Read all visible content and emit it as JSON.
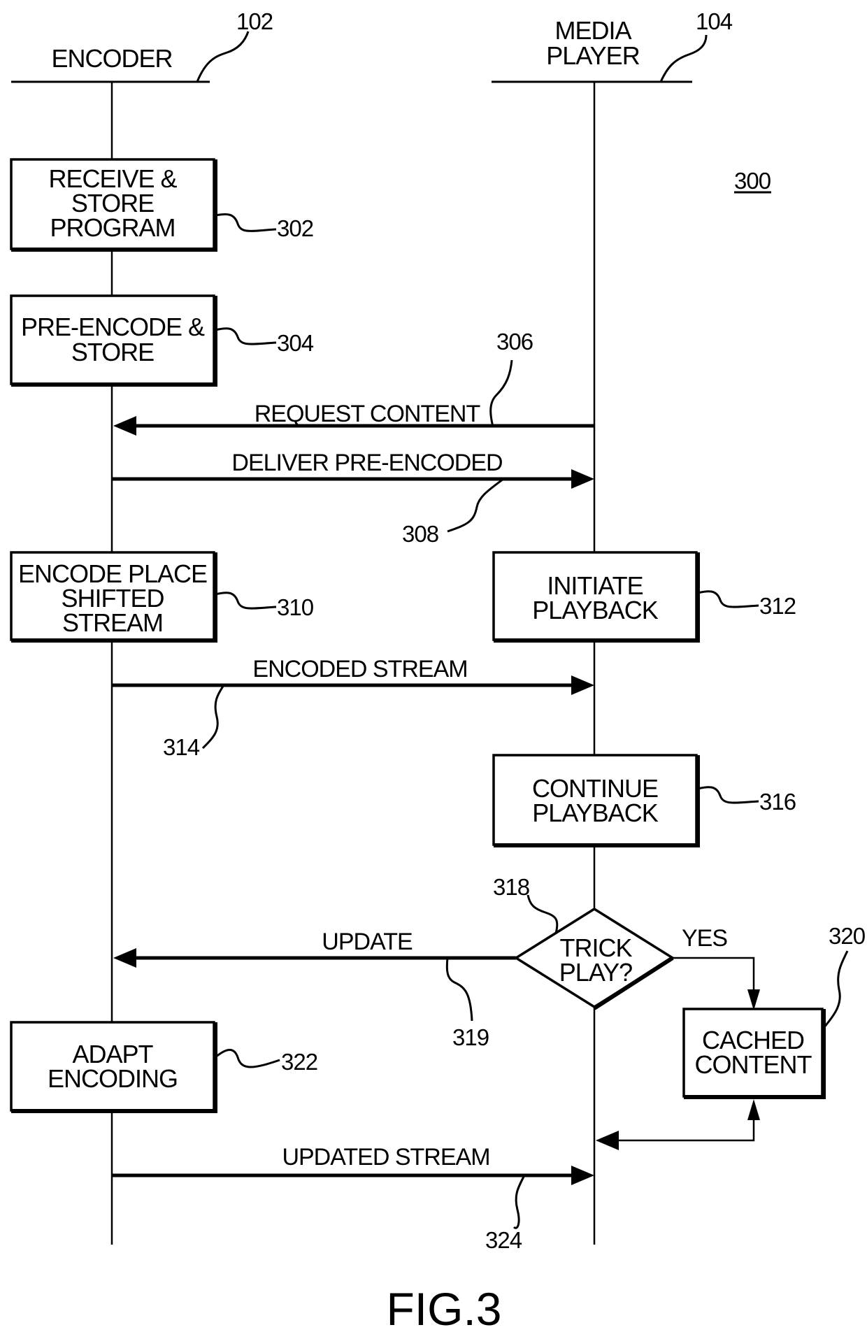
{
  "figure": {
    "diagram_number": "300",
    "caption": "FIG.3"
  },
  "lifelines": [
    {
      "id": "encoder",
      "label_lines": [
        "ENCODER"
      ],
      "ref": "102"
    },
    {
      "id": "media_player",
      "label_lines": [
        "MEDIA",
        "PLAYER"
      ],
      "ref": "104"
    }
  ],
  "steps": [
    {
      "id": "302",
      "ref": "302",
      "lane": "encoder",
      "lines": [
        "RECEIVE &",
        "STORE",
        "PROGRAM"
      ]
    },
    {
      "id": "304",
      "ref": "304",
      "lane": "encoder",
      "lines": [
        "PRE-ENCODE &",
        "STORE"
      ]
    },
    {
      "id": "310",
      "ref": "310",
      "lane": "encoder",
      "lines": [
        "ENCODE PLACE",
        "SHIFTED",
        "STREAM"
      ]
    },
    {
      "id": "312",
      "ref": "312",
      "lane": "media_player",
      "lines": [
        "INITIATE",
        "PLAYBACK"
      ]
    },
    {
      "id": "316",
      "ref": "316",
      "lane": "media_player",
      "lines": [
        "CONTINUE",
        "PLAYBACK"
      ]
    },
    {
      "id": "320",
      "ref": "320",
      "lane": "side",
      "lines": [
        "CACHED",
        "CONTENT"
      ]
    },
    {
      "id": "322",
      "ref": "322",
      "lane": "encoder",
      "lines": [
        "ADAPT",
        "ENCODING"
      ]
    }
  ],
  "decision": {
    "id": "318",
    "ref": "318",
    "lines": [
      "TRICK",
      "PLAY?"
    ],
    "yes_label": "YES"
  },
  "messages": [
    {
      "id": "306",
      "ref": "306",
      "label": "REQUEST CONTENT",
      "from": "media_player",
      "to": "encoder"
    },
    {
      "id": "308",
      "ref": "308",
      "label": "DELIVER PRE-ENCODED",
      "from": "encoder",
      "to": "media_player"
    },
    {
      "id": "314",
      "ref": "314",
      "label": "ENCODED STREAM",
      "from": "encoder",
      "to": "media_player"
    },
    {
      "id": "319",
      "ref": "319",
      "label": "UPDATE",
      "from": "decision",
      "to": "encoder"
    },
    {
      "id": "324",
      "ref": "324",
      "label": "UPDATED STREAM",
      "from": "encoder",
      "to": "media_player"
    }
  ]
}
